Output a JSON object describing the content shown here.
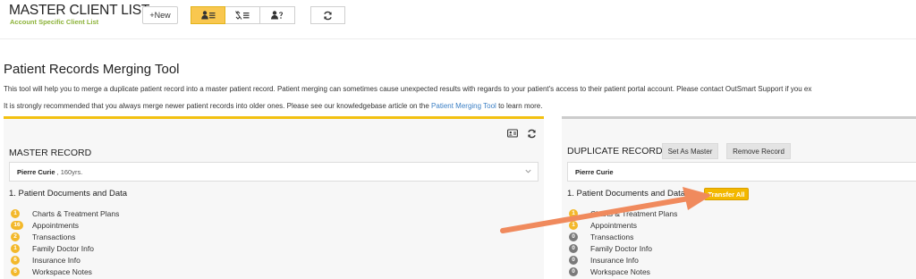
{
  "header": {
    "title": "MASTER CLIENT LIST",
    "subtitle": "Account Specific Client List",
    "new_label": "+New",
    "view_buttons": [
      {
        "icon": "person-list-icon"
      },
      {
        "icon": "unlinked-list-icon"
      },
      {
        "icon": "person-question-icon"
      }
    ],
    "refresh_icon": "refresh-icon"
  },
  "tool": {
    "title": "Patient Records Merging Tool",
    "intro1": "This tool will help you to merge a duplicate patient record into a master patient record. Patient merging can sometimes cause unexpected results with regards to your patient's access to their patient portal account. Please contact OutSmart Support if you ex",
    "intro2_before": "It is strongly recommended that you always merge newer patient records into older ones. Please see our knowledgebase article on the ",
    "intro2_link": "Patient Merging Tool",
    "intro2_after": " to learn more."
  },
  "master": {
    "heading": "MASTER RECORD",
    "selected_name": "Pierre Curie",
    "selected_age": ", 160yrs.",
    "section_title": "1. Patient Documents and Data",
    "items": [
      {
        "count": "1",
        "label": "Charts & Treatment Plans"
      },
      {
        "count": "16",
        "label": "Appointments"
      },
      {
        "count": "2",
        "label": "Transactions"
      },
      {
        "count": "1",
        "label": "Family Doctor Info"
      },
      {
        "count": "6",
        "label": "Insurance Info"
      },
      {
        "count": "6",
        "label": "Workspace Notes"
      }
    ]
  },
  "duplicate": {
    "heading": "DUPLICATE RECORD",
    "set_master_label": "Set As Master",
    "remove_label": "Remove Record",
    "selected_name": "Pierre Curie",
    "section_title": "1. Patient Documents and Data",
    "transfer_all_label": "Transfer All",
    "items": [
      {
        "count": "1",
        "label": "Charts & Treatment Plans"
      },
      {
        "count": "1",
        "label": "Appointments"
      },
      {
        "count": "0",
        "label": "Transactions"
      },
      {
        "count": "0",
        "label": "Family Doctor Info"
      },
      {
        "count": "0",
        "label": "Insurance Info"
      },
      {
        "count": "0",
        "label": "Workspace Notes"
      }
    ]
  },
  "colors": {
    "accent": "#f3c111",
    "link": "#3b7fc4",
    "subtitle_green": "#8db33a",
    "arrow": "#f08a5d"
  }
}
